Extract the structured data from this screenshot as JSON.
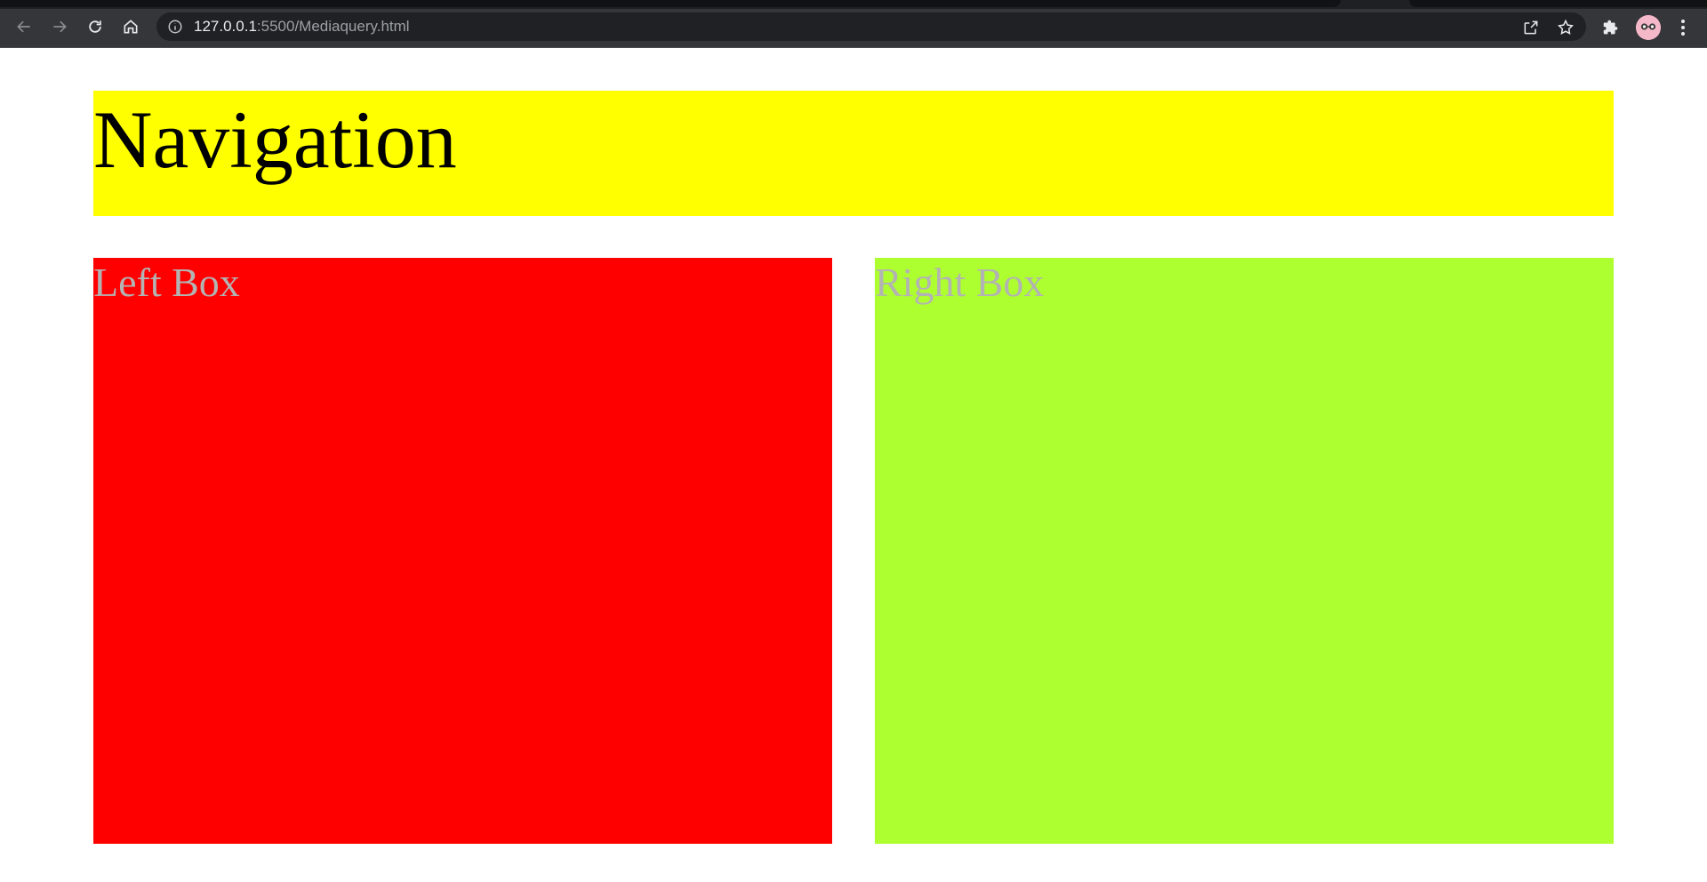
{
  "browser": {
    "url_host": "127.0.0.1",
    "url_path": ":5500/Mediaquery.html"
  },
  "page": {
    "navigation": "Navigation",
    "left_box": "Left Box",
    "right_box": "Right Box"
  },
  "colors": {
    "navigation_bg": "#ffff00",
    "left_box_bg": "#ff0000",
    "right_box_bg": "#adff2f",
    "box_text": "#b3b3b3"
  }
}
